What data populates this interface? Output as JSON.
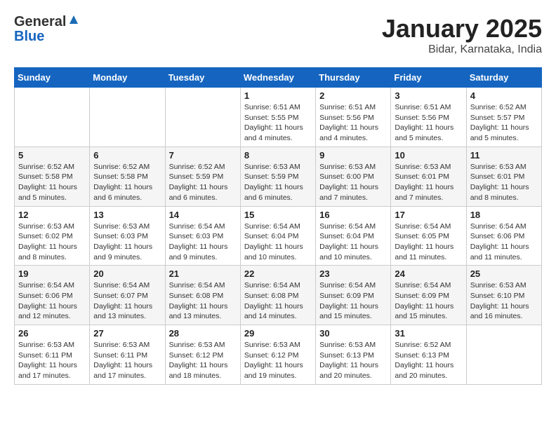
{
  "header": {
    "logo_line1": "General",
    "logo_line2": "Blue",
    "month_title": "January 2025",
    "location": "Bidar, Karnataka, India"
  },
  "weekdays": [
    "Sunday",
    "Monday",
    "Tuesday",
    "Wednesday",
    "Thursday",
    "Friday",
    "Saturday"
  ],
  "weeks": [
    [
      {
        "day": "",
        "info": ""
      },
      {
        "day": "",
        "info": ""
      },
      {
        "day": "",
        "info": ""
      },
      {
        "day": "1",
        "info": "Sunrise: 6:51 AM\nSunset: 5:55 PM\nDaylight: 11 hours\nand 4 minutes."
      },
      {
        "day": "2",
        "info": "Sunrise: 6:51 AM\nSunset: 5:56 PM\nDaylight: 11 hours\nand 4 minutes."
      },
      {
        "day": "3",
        "info": "Sunrise: 6:51 AM\nSunset: 5:56 PM\nDaylight: 11 hours\nand 5 minutes."
      },
      {
        "day": "4",
        "info": "Sunrise: 6:52 AM\nSunset: 5:57 PM\nDaylight: 11 hours\nand 5 minutes."
      }
    ],
    [
      {
        "day": "5",
        "info": "Sunrise: 6:52 AM\nSunset: 5:58 PM\nDaylight: 11 hours\nand 5 minutes."
      },
      {
        "day": "6",
        "info": "Sunrise: 6:52 AM\nSunset: 5:58 PM\nDaylight: 11 hours\nand 6 minutes."
      },
      {
        "day": "7",
        "info": "Sunrise: 6:52 AM\nSunset: 5:59 PM\nDaylight: 11 hours\nand 6 minutes."
      },
      {
        "day": "8",
        "info": "Sunrise: 6:53 AM\nSunset: 5:59 PM\nDaylight: 11 hours\nand 6 minutes."
      },
      {
        "day": "9",
        "info": "Sunrise: 6:53 AM\nSunset: 6:00 PM\nDaylight: 11 hours\nand 7 minutes."
      },
      {
        "day": "10",
        "info": "Sunrise: 6:53 AM\nSunset: 6:01 PM\nDaylight: 11 hours\nand 7 minutes."
      },
      {
        "day": "11",
        "info": "Sunrise: 6:53 AM\nSunset: 6:01 PM\nDaylight: 11 hours\nand 8 minutes."
      }
    ],
    [
      {
        "day": "12",
        "info": "Sunrise: 6:53 AM\nSunset: 6:02 PM\nDaylight: 11 hours\nand 8 minutes."
      },
      {
        "day": "13",
        "info": "Sunrise: 6:53 AM\nSunset: 6:03 PM\nDaylight: 11 hours\nand 9 minutes."
      },
      {
        "day": "14",
        "info": "Sunrise: 6:54 AM\nSunset: 6:03 PM\nDaylight: 11 hours\nand 9 minutes."
      },
      {
        "day": "15",
        "info": "Sunrise: 6:54 AM\nSunset: 6:04 PM\nDaylight: 11 hours\nand 10 minutes."
      },
      {
        "day": "16",
        "info": "Sunrise: 6:54 AM\nSunset: 6:04 PM\nDaylight: 11 hours\nand 10 minutes."
      },
      {
        "day": "17",
        "info": "Sunrise: 6:54 AM\nSunset: 6:05 PM\nDaylight: 11 hours\nand 11 minutes."
      },
      {
        "day": "18",
        "info": "Sunrise: 6:54 AM\nSunset: 6:06 PM\nDaylight: 11 hours\nand 11 minutes."
      }
    ],
    [
      {
        "day": "19",
        "info": "Sunrise: 6:54 AM\nSunset: 6:06 PM\nDaylight: 11 hours\nand 12 minutes."
      },
      {
        "day": "20",
        "info": "Sunrise: 6:54 AM\nSunset: 6:07 PM\nDaylight: 11 hours\nand 13 minutes."
      },
      {
        "day": "21",
        "info": "Sunrise: 6:54 AM\nSunset: 6:08 PM\nDaylight: 11 hours\nand 13 minutes."
      },
      {
        "day": "22",
        "info": "Sunrise: 6:54 AM\nSunset: 6:08 PM\nDaylight: 11 hours\nand 14 minutes."
      },
      {
        "day": "23",
        "info": "Sunrise: 6:54 AM\nSunset: 6:09 PM\nDaylight: 11 hours\nand 15 minutes."
      },
      {
        "day": "24",
        "info": "Sunrise: 6:54 AM\nSunset: 6:09 PM\nDaylight: 11 hours\nand 15 minutes."
      },
      {
        "day": "25",
        "info": "Sunrise: 6:53 AM\nSunset: 6:10 PM\nDaylight: 11 hours\nand 16 minutes."
      }
    ],
    [
      {
        "day": "26",
        "info": "Sunrise: 6:53 AM\nSunset: 6:11 PM\nDaylight: 11 hours\nand 17 minutes."
      },
      {
        "day": "27",
        "info": "Sunrise: 6:53 AM\nSunset: 6:11 PM\nDaylight: 11 hours\nand 17 minutes."
      },
      {
        "day": "28",
        "info": "Sunrise: 6:53 AM\nSunset: 6:12 PM\nDaylight: 11 hours\nand 18 minutes."
      },
      {
        "day": "29",
        "info": "Sunrise: 6:53 AM\nSunset: 6:12 PM\nDaylight: 11 hours\nand 19 minutes."
      },
      {
        "day": "30",
        "info": "Sunrise: 6:53 AM\nSunset: 6:13 PM\nDaylight: 11 hours\nand 20 minutes."
      },
      {
        "day": "31",
        "info": "Sunrise: 6:52 AM\nSunset: 6:13 PM\nDaylight: 11 hours\nand 20 minutes."
      },
      {
        "day": "",
        "info": ""
      }
    ]
  ]
}
